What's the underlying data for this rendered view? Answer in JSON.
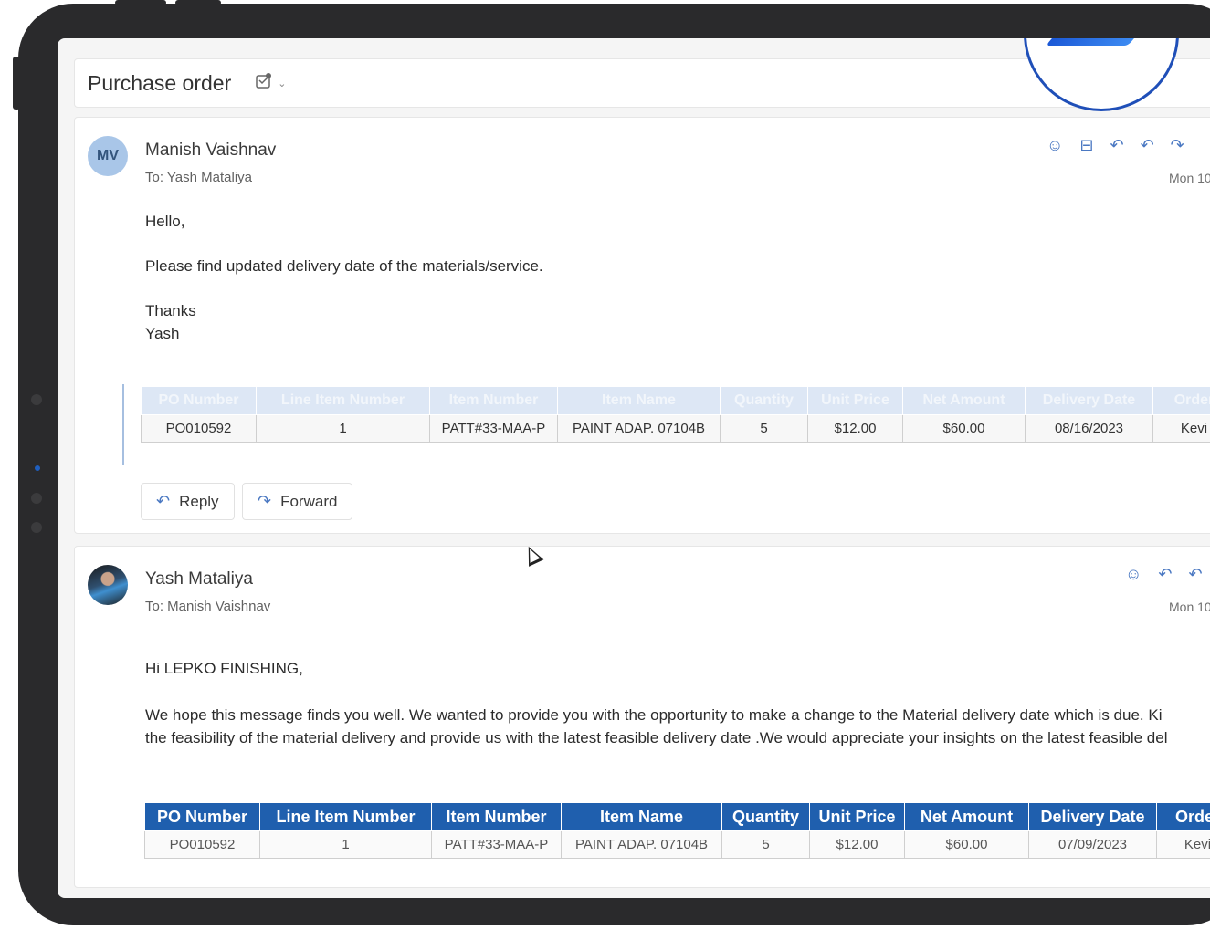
{
  "subject": {
    "title": "Purchase order",
    "icon": "tag-icon",
    "chevron": "⌄"
  },
  "colors": {
    "accent": "#1f5fae",
    "link_blue": "#4a78c2",
    "avatar_bg": "#a9c6e8"
  },
  "messages": [
    {
      "initials": "MV",
      "sender": "Manish Vaishnav",
      "to": "To: Yash Mataliya",
      "date": "Mon 10",
      "greeting": "Hello,",
      "body": "Please find updated delivery date of the materials/service.",
      "sign_1": "Thanks",
      "sign_2": "Yash",
      "table": {
        "headers": [
          "PO Number",
          "Line Item Number",
          "Item Number",
          "Item Name",
          "Quantity",
          "Unit Price",
          "Net Amount",
          "Delivery Date",
          "Order"
        ],
        "row": [
          "PO010592",
          "1",
          "PATT#33-MAA-P",
          "PAINT ADAP. 07104B",
          "5",
          "$12.00",
          "$60.00",
          "08/16/2023",
          "Kevi"
        ]
      },
      "reply_label": "Reply",
      "forward_label": "Forward"
    },
    {
      "sender": "Yash Mataliya",
      "to": "To: Manish Vaishnav",
      "date": "Mon 10",
      "greeting": "Hi LEPKO FINISHING,",
      "body_1": "We hope this message finds you well. We wanted to provide you with the opportunity to make a change to the Material delivery date  which is due. Ki",
      "body_2": "the feasibility of the material delivery and provide us with the latest feasible delivery date .We would appreciate your insights on the latest feasible del",
      "table": {
        "headers": [
          "PO Number",
          "Line Item Number",
          "Item Number",
          "Item Name",
          "Quantity",
          "Unit Price",
          "Net Amount",
          "Delivery Date",
          "Order"
        ],
        "row": [
          "PO010592",
          "1",
          "PATT#33-MAA-P",
          "PAINT ADAP. 07104B",
          "5",
          "$12.00",
          "$60.00",
          "07/09/2023",
          "Kevi"
        ]
      }
    }
  ]
}
